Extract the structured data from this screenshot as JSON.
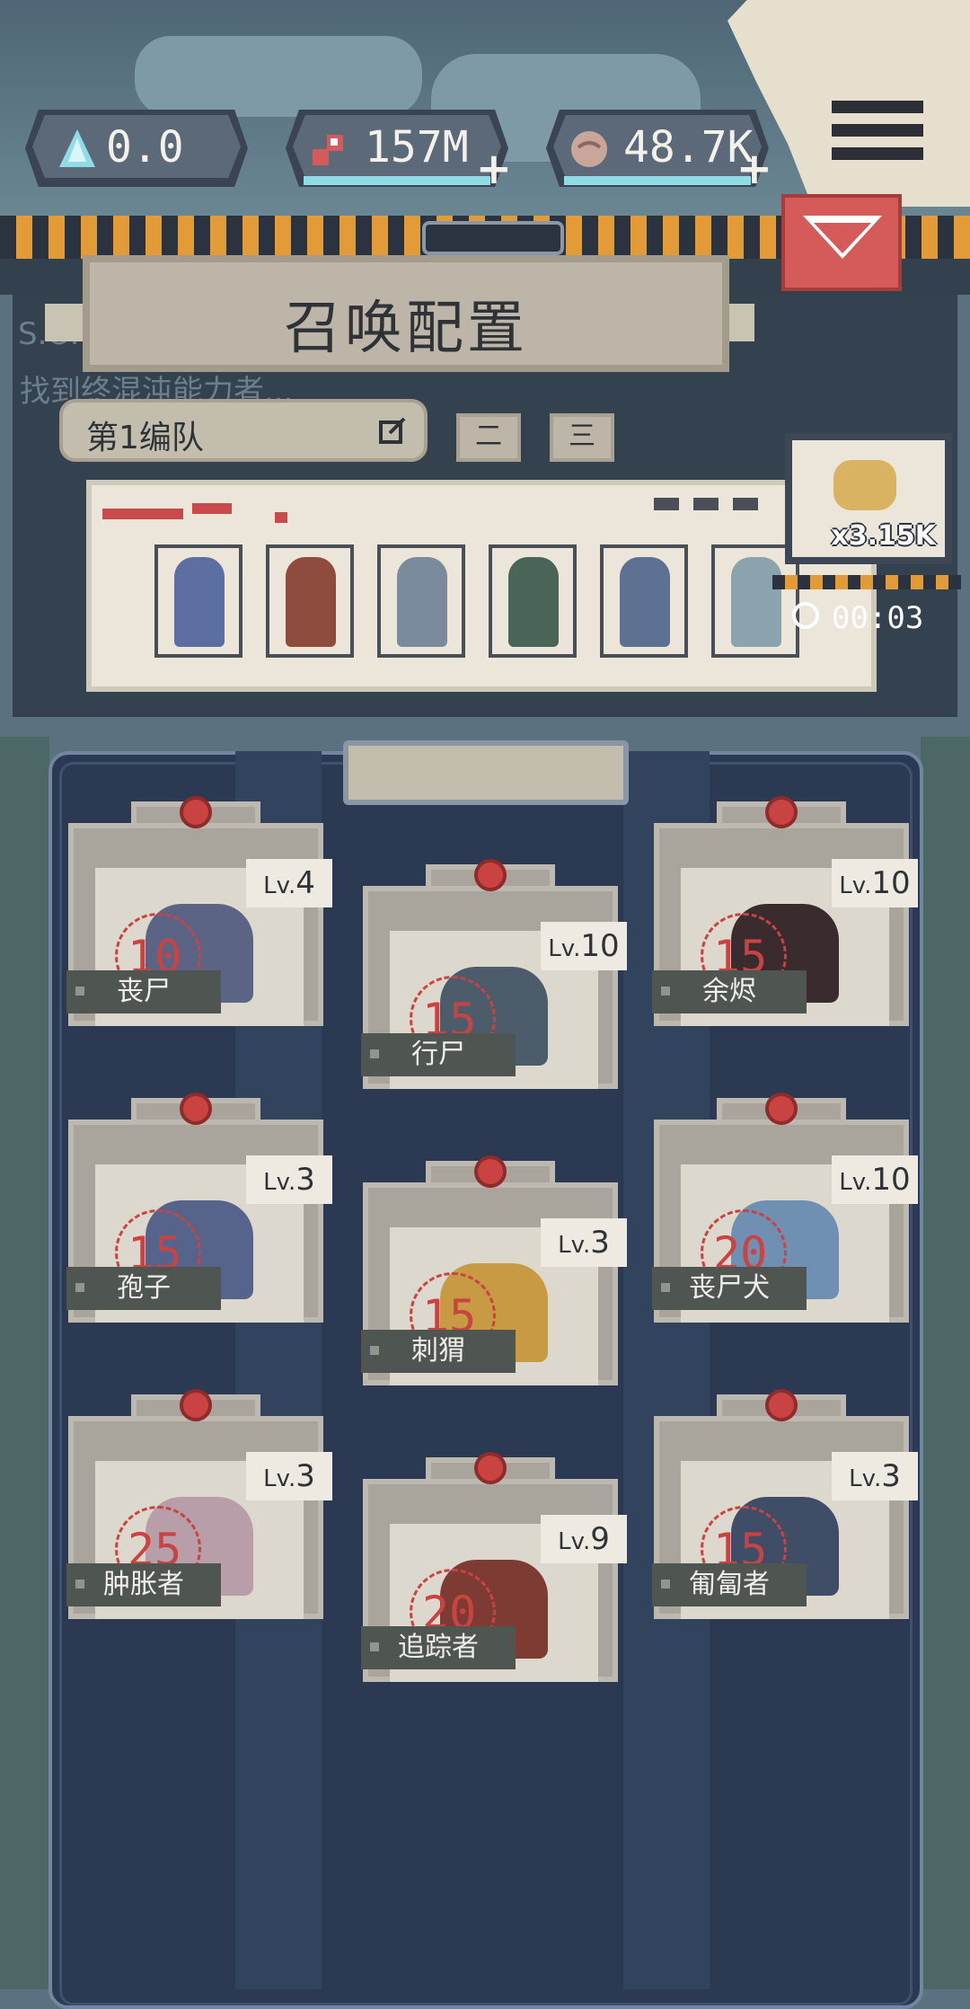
{
  "resources": [
    {
      "name": "crystal",
      "value": "0.0",
      "icon": "crystal-icon",
      "color": "#8fdbe6",
      "plus": false
    },
    {
      "name": "flesh",
      "value": "157M",
      "icon": "flesh-icon",
      "color": "#d55b5b",
      "plus": true
    },
    {
      "name": "brain",
      "value": "48.7K",
      "icon": "brain-icon",
      "color": "#c9a59a",
      "plus": true
    }
  ],
  "header": {
    "title": "召唤配置",
    "menu_icon": "hamburger-menu-icon",
    "dropdown_icon": "collapse-arrow-icon"
  },
  "background_text": {
    "line1": "S.O.",
    "line2": "找到终混沌能力者..."
  },
  "squad": {
    "name": "第1编队",
    "edit_icon": "edit-icon",
    "tabs": [
      "二",
      "三"
    ]
  },
  "bonus": {
    "multiplier": "x3.15K",
    "timer": "00:03",
    "icon": "coin-stack-icon"
  },
  "lineup": [
    {
      "name": "miner-zombie",
      "color": "#5c6fa0"
    },
    {
      "name": "brain-zombie",
      "color": "#8e4b3e"
    },
    {
      "name": "ant-zombie",
      "color": "#7b8a9c"
    },
    {
      "name": "plant-zombie",
      "color": "#4a6458"
    },
    {
      "name": "crawler",
      "color": "#5d7193"
    },
    {
      "name": "ghost",
      "color": "#8aa3ad"
    }
  ],
  "cards": [
    {
      "name": "丧尸",
      "cost": "10",
      "lv": "4",
      "color": "#5b6485"
    },
    {
      "name": "行尸",
      "cost": "15",
      "lv": "10",
      "color": "#4d5c6a"
    },
    {
      "name": "余烬",
      "cost": "15",
      "lv": "10",
      "color": "#3a2b2e"
    },
    {
      "name": "孢子",
      "cost": "15",
      "lv": "3",
      "color": "#56648c"
    },
    {
      "name": "刺猬",
      "cost": "15",
      "lv": "3",
      "color": "#c99a44"
    },
    {
      "name": "丧尸犬",
      "cost": "20",
      "lv": "10",
      "color": "#6f8fb3"
    },
    {
      "name": "肿胀者",
      "cost": "25",
      "lv": "3",
      "color": "#b79ea8"
    },
    {
      "name": "追踪者",
      "cost": "20",
      "lv": "9",
      "color": "#7e3b34"
    },
    {
      "name": "匍匐者",
      "cost": "15",
      "lv": "3",
      "color": "#3f4d66"
    }
  ],
  "lv_prefix": "Lv."
}
